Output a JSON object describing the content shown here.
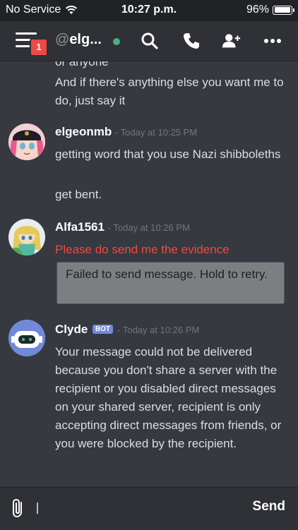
{
  "status_bar": {
    "carrier": "No Service",
    "time": "10:27 p.m.",
    "battery_percent": "96%",
    "battery_level": 0.96,
    "wifi_icon": "wifi-icon"
  },
  "nav": {
    "badge_count": "1",
    "channel_at": "@",
    "channel_name": "elg...",
    "online_color": "#43b581",
    "icons": [
      "search-icon",
      "phone-icon",
      "add-friend-icon",
      "more-icon"
    ]
  },
  "messages": {
    "clipped_top": "or anyone",
    "prev_text": "And if there's anything else you want me to do, just say it",
    "m1": {
      "username": "elgeonmb",
      "timestamp": "- Today at 10:25 PM",
      "lines": [
        "getting word that you use Nazi shibboleths",
        "get bent."
      ]
    },
    "m2": {
      "username": "Alfa1561",
      "timestamp": "- Today at 10:26 PM",
      "text": "Please do send me the evidence",
      "failed_notice": "Failed to send message. Hold to retry."
    },
    "m3": {
      "username": "Clyde",
      "bot_tag": "BOT",
      "timestamp": "- Today at 10:26 PM",
      "text": "Your message could not be delivered because you don't share a server with the recipient or you disabled direct messages on your shared server, recipient is only accepting direct messages from friends, or you were blocked by the recipient."
    }
  },
  "input": {
    "value": "",
    "placeholder": "",
    "send_label": "Send"
  },
  "colors": {
    "background": "#36393f",
    "error": "#f04747",
    "blurple": "#7289da"
  }
}
